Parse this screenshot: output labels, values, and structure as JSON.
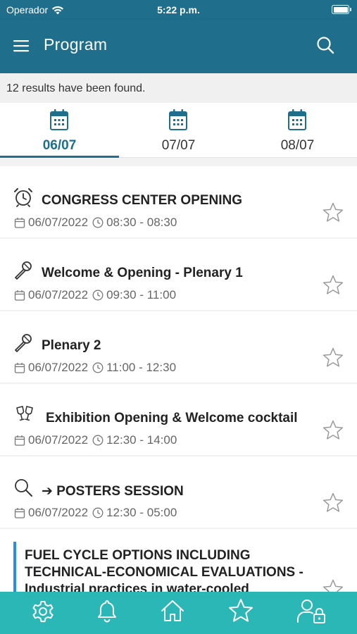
{
  "status_bar": {
    "carrier": "Operador",
    "time": "5:22 p.m."
  },
  "app_bar": {
    "title": "Program",
    "menu_icon": "hamburger-menu-icon",
    "search_icon": "search-icon"
  },
  "results_text": "12 results have been found.",
  "tabs": [
    {
      "label": "06/07",
      "active": true
    },
    {
      "label": "07/07",
      "active": false
    },
    {
      "label": "08/07",
      "active": false
    }
  ],
  "items": [
    {
      "icon": "alarm-clock-icon",
      "title": "CONGRESS CENTER OPENING",
      "date": "06/07/2022",
      "time": "08:30 - 08:30"
    },
    {
      "icon": "microphone-icon",
      "title": "Welcome & Opening - Plenary 1",
      "date": "06/07/2022",
      "time": "09:30 - 11:00"
    },
    {
      "icon": "microphone-icon",
      "title": "Plenary 2",
      "date": "06/07/2022",
      "time": "11:00 - 12:30"
    },
    {
      "icon": "cheers-glasses-icon",
      "title": "Exhibition Opening & Welcome cocktail",
      "date": "06/07/2022",
      "time": "12:30 - 14:00"
    },
    {
      "icon": "magnifier-icon",
      "title": "➔ POSTERS SESSION",
      "date": "06/07/2022",
      "time": "12:30 - 05:00"
    }
  ],
  "partial_item": {
    "line1": "FUEL CYCLE OPTIONS INCLUDING",
    "line2": "TECHNICAL-ECONOMICAL EVALUATIONS -",
    "line3": "Industrial  practices in water-cooled"
  },
  "bottom_nav": [
    "settings-gear-icon",
    "bell-icon",
    "home-icon",
    "star-icon",
    "user-lock-icon"
  ],
  "colors": {
    "header": "#1e6e8c",
    "bottom_bar": "#2bb7b6",
    "accent_bar": "#2a8de0"
  }
}
